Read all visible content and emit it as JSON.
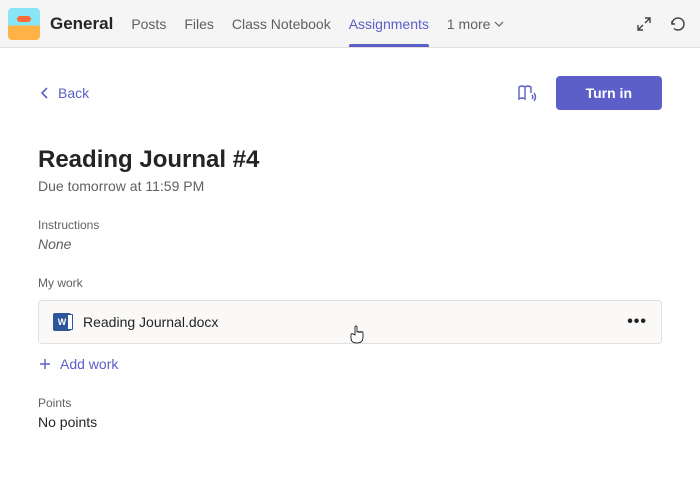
{
  "header": {
    "channel_name": "General",
    "tabs": [
      "Posts",
      "Files",
      "Class Notebook",
      "Assignments"
    ],
    "active_tab_index": 3,
    "more_label": "1 more"
  },
  "assignment": {
    "back_label": "Back",
    "turn_in_label": "Turn in",
    "title": "Reading Journal #4",
    "due": "Due tomorrow at 11:59 PM",
    "instructions_label": "Instructions",
    "instructions_value": "None",
    "mywork_label": "My work",
    "file_name": "Reading Journal.docx",
    "add_work_label": "Add work",
    "points_label": "Points",
    "points_value": "No points"
  }
}
